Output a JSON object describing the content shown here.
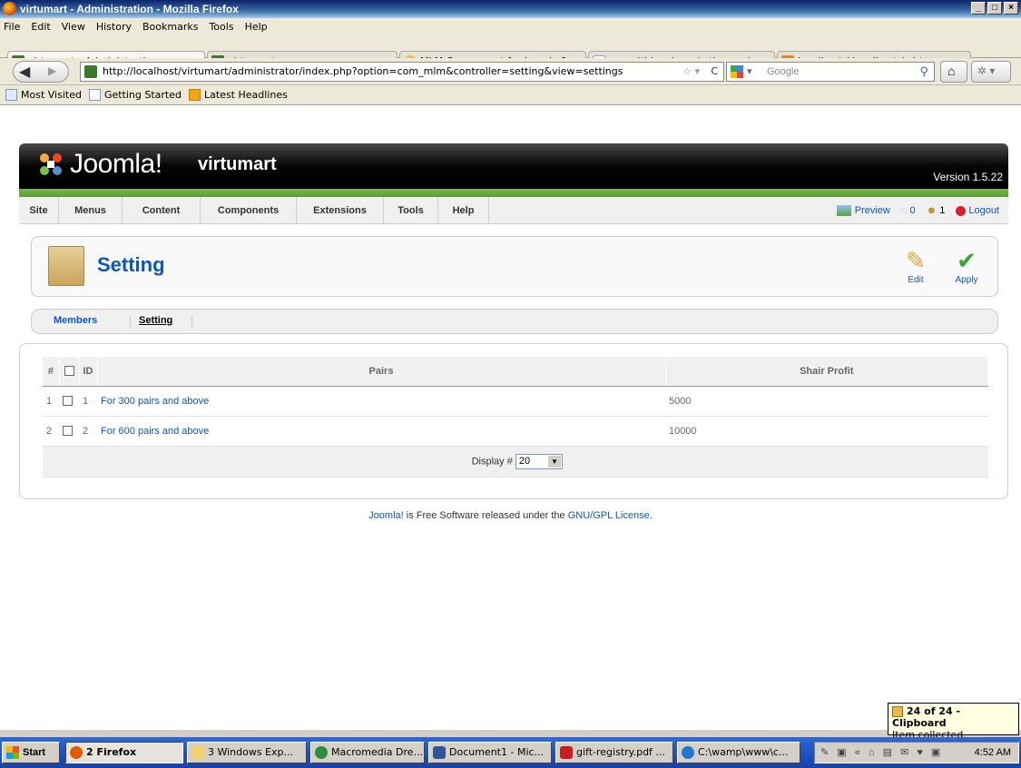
{
  "window": {
    "title": "virtumart - Administration - Mozilla Firefox"
  },
  "menu": [
    "File",
    "Edit",
    "View",
    "History",
    "Bookmarks",
    "Tools",
    "Help"
  ],
  "tabs": [
    {
      "label": "virtumart - Administration",
      "color": "#3c7a2a"
    },
    {
      "label": "virtumart",
      "color": "#3c7a2a"
    },
    {
      "label": "MLM Component for Joomla 1...",
      "color": "#f2c230"
    },
    {
      "label": "rs.multi-level marketing and ...",
      "color": "#8aa9d6"
    },
    {
      "label": "localhost / localhost / virtuma...",
      "color": "#e08a1a"
    }
  ],
  "nav": {
    "url": "http://localhost/virtumart/administrator/index.php?option=com_mlm&controller=setting&view=settings",
    "search_placeholder": "Google"
  },
  "bookmarks": [
    "Most Visited",
    "Getting Started",
    "Latest Headlines"
  ],
  "joomla": {
    "logo_text": "Joomla!",
    "site_name": "virtumart",
    "version": "Version 1.5.22",
    "menu": [
      "Site",
      "Menus",
      "Content",
      "Components",
      "Extensions",
      "Tools",
      "Help"
    ],
    "right": {
      "preview": "Preview",
      "messages": "0",
      "users": "1",
      "logout": "Logout"
    },
    "page_title": "Setting",
    "toolbar": {
      "edit": "Edit",
      "apply": "Apply"
    },
    "subnav": [
      "Members",
      "Setting"
    ]
  },
  "table": {
    "headers": {
      "num": "#",
      "id": "ID",
      "pairs": "Pairs",
      "profit": "Shair Profit"
    },
    "rows": [
      {
        "num": "1",
        "id": "1",
        "pairs": "For 300 pairs and above",
        "profit": "5000"
      },
      {
        "num": "2",
        "id": "2",
        "pairs": "For 600 pairs and above",
        "profit": "10000"
      }
    ],
    "display_label": "Display #",
    "display_value": "20"
  },
  "footer": {
    "joomla": "Joomla!",
    "mid": " is Free Software released under the ",
    "license": "GNU/GPL License",
    "end": "."
  },
  "clipboard": {
    "title": "24 of 24 - Clipboard",
    "text": "Item collected."
  },
  "taskbar": {
    "start": "Start",
    "tasks": [
      "2 Firefox",
      "3 Windows Exp...",
      "Macromedia Dre...",
      "Document1 - Mic...",
      "gift-registry.pdf ...",
      "C:\\wamp\\www\\c..."
    ],
    "clock": "4:52 AM"
  }
}
